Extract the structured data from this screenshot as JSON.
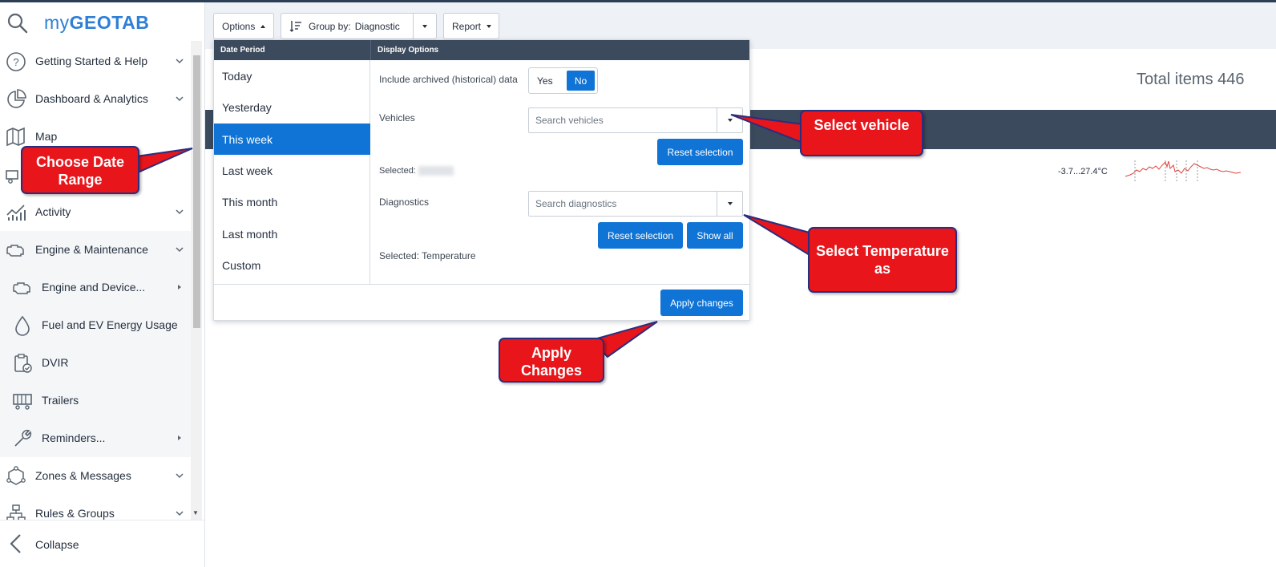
{
  "app": {
    "logo_prefix": "my",
    "logo_main": "GEOTAB"
  },
  "sidebar": {
    "items": [
      {
        "label": "Getting Started & Help",
        "icon": "help-circle-icon"
      },
      {
        "label": "Dashboard & Analytics",
        "icon": "pie-chart-icon"
      },
      {
        "label": "Map",
        "icon": "map-icon"
      },
      {
        "label": "",
        "icon": "truck-icon"
      },
      {
        "label": "Activity",
        "icon": "activity-chart-icon"
      },
      {
        "label": "Engine & Maintenance",
        "icon": "engine-icon"
      },
      {
        "label": "Engine and Device...",
        "icon": "engine-icon"
      },
      {
        "label": "Fuel and EV Energy Usage",
        "icon": "fuel-drop-icon"
      },
      {
        "label": "DVIR",
        "icon": "clipboard-check-icon"
      },
      {
        "label": "Trailers",
        "icon": "trailer-icon"
      },
      {
        "label": "Reminders...",
        "icon": "wrench-icon"
      },
      {
        "label": "Zones & Messages",
        "icon": "zones-icon"
      },
      {
        "label": "Rules & Groups",
        "icon": "hierarchy-icon"
      }
    ],
    "collapse_label": "Collapse"
  },
  "toolbar": {
    "options_label": "Options",
    "group_by_prefix": "Group by:",
    "group_by_value": "Diagnostic",
    "report_label": "Report"
  },
  "content": {
    "total_items": "Total items 446",
    "temp_range": "-3.7...27.4°C"
  },
  "options_panel": {
    "date_period_header": "Date Period",
    "display_options_header": "Display Options",
    "periods": [
      "Today",
      "Yesterday",
      "This week",
      "Last week",
      "This month",
      "Last month",
      "Custom"
    ],
    "selected_period": "This week",
    "include_archived_label": "Include archived (historical) data",
    "yes_label": "Yes",
    "no_label": "No",
    "archived_selected": "No",
    "vehicles_label": "Vehicles",
    "vehicles_placeholder": "Search vehicles",
    "reset_selection_label": "Reset selection",
    "vehicles_selected_prefix": "Selected:",
    "diagnostics_label": "Diagnostics",
    "diagnostics_placeholder": "Search diagnostics",
    "show_all_label": "Show all",
    "diagnostics_selected": "Selected: Temperature",
    "apply_changes_label": "Apply changes"
  },
  "callouts": {
    "date_range": "Choose Date Range",
    "select_vehicle": "Select vehicle",
    "select_temperature": "Select Temperature as",
    "apply_changes": "Apply Changes"
  },
  "colors": {
    "accent": "#0f74d6",
    "header_dark": "#3b4a5c",
    "callout_red": "#e8151b",
    "callout_border": "#2b2d7e",
    "sparkline": "#e0443e"
  }
}
